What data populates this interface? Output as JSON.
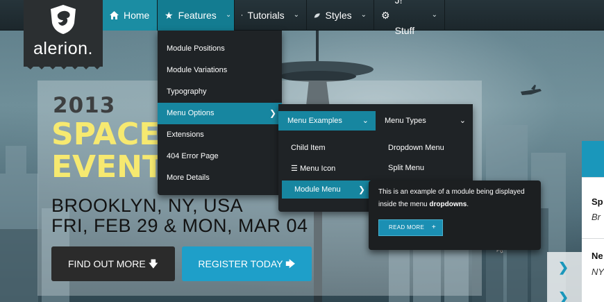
{
  "logo": {
    "text": "alerion."
  },
  "nav": {
    "home": "Home",
    "features": "Features",
    "tutorials": "Tutorials",
    "styles": "Styles",
    "jstuff": "J! Stuff"
  },
  "dropdown1": {
    "items": [
      "Module Positions",
      "Module Variations",
      "Typography",
      "Menu Options",
      "Extensions",
      "404 Error Page",
      "More Details"
    ]
  },
  "dropdown2": {
    "menu_examples": "Menu Examples",
    "menu_types": "Menu Types",
    "child_item": "Child Item",
    "menu_icon": "Menu Icon",
    "module_menu": "Module Menu",
    "dropdown_menu": "Dropdown Menu",
    "split_menu": "Split Menu"
  },
  "popup": {
    "text_before": "This is an example of a module being displayed inside the menu ",
    "text_bold": "dropdowns",
    "text_after": ".",
    "button": "READ MORE",
    "button_icon": "+"
  },
  "hero": {
    "year": "2013",
    "title_line1": "SPACE NEEDLE",
    "title_line2": "EVENT",
    "place": "BROOKLYN, NY, USA",
    "date": "FRI, FEB 29 & MON, MAR 04",
    "btn_find": "FIND OUT MORE",
    "btn_register": "REGISTER TODAY"
  },
  "side": {
    "item1_title": "Sp",
    "item1_sub": "Br",
    "item2_title": "Ne",
    "item2_sub": "NY"
  },
  "colors": {
    "accent": "#1786a0",
    "button_blue": "#1e9fc9",
    "title_yellow": "#f6e970"
  }
}
